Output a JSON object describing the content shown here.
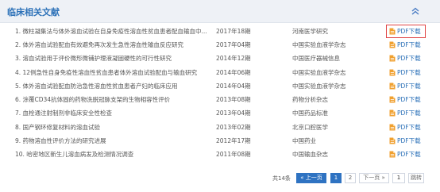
{
  "panel": {
    "title": "临床相关文献"
  },
  "pdf_label": "PDF下载",
  "articles": [
    {
      "title": "1. 微柱凝集法与体外溶血试验在自身免疫性溶血性贫血患者配血输血中...",
      "period": "2017年18期",
      "journal": "河南医学研究"
    },
    {
      "title": "2. 体外溶血试验配血有效避免再次发生急性溶血性输血反应研究",
      "period": "2017年04期",
      "journal": "中国实验血液学杂志"
    },
    {
      "title": "3. 溶血试验用于评价微形微铺护理液凝固硬性的可行性研究",
      "period": "2014年12期",
      "journal": "中国医疗器械信息"
    },
    {
      "title": "4. 12例急性自身免疫性溶血性贫血患者体外溶血试验配血与输血研究",
      "period": "2014年06期",
      "journal": "中国实验血液学杂志"
    },
    {
      "title": "5. 体外溶血试验配血防治急性溶血性贫血患者产妇的临床应用",
      "period": "2014年04期",
      "journal": "中国实验血液学杂志"
    },
    {
      "title": "6. 涂覆CD34抗体固的药物洗脱冠脉支架的生物相容性评价",
      "period": "2013年08期",
      "journal": "药物分析杂志"
    },
    {
      "title": "7. 血栓通注射制剂非临床安全性检查",
      "period": "2013年04期",
      "journal": "中国药品标准"
    },
    {
      "title": "8. 国产钢环修复材料的溶血试验",
      "period": "2013年02期",
      "journal": "北京口腔医学"
    },
    {
      "title": "9. 药物溶血性评价方法的研究进展",
      "period": "2012年17期",
      "journal": "中国药业"
    },
    {
      "title": "10. 哈密地区新生儿溶血病发及检测情况调查",
      "period": "2011年08期",
      "journal": "中国输血杂志"
    }
  ],
  "pagination": {
    "total": "共14条",
    "prev": "« 上一页",
    "pages": [
      "1",
      "2"
    ],
    "current": "1",
    "next": "下一页 »",
    "goto_value": "1",
    "jump": "跳转"
  },
  "colors": {
    "accent": "#2c71b8",
    "highlight": "#e04343",
    "pdf_icon": "#f0a030"
  }
}
